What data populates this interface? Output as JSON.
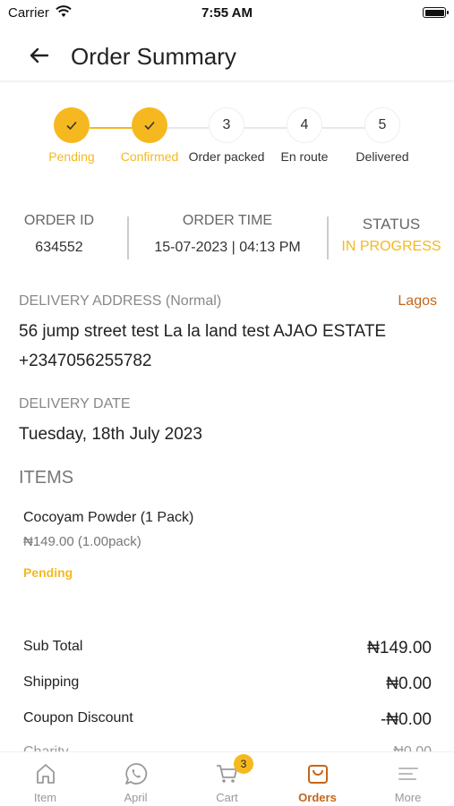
{
  "status_bar": {
    "carrier": "Carrier",
    "time": "7:55 AM"
  },
  "header": {
    "title": "Order Summary",
    "back_icon": "arrow-left-icon"
  },
  "progress": {
    "steps": [
      {
        "label": "Pending",
        "done": true
      },
      {
        "label": "Confirmed",
        "done": true
      },
      {
        "label": "Order packed",
        "number": "3",
        "done": false
      },
      {
        "label": "En route",
        "number": "4",
        "done": false
      },
      {
        "label": "Delivered",
        "number": "5",
        "done": false
      }
    ]
  },
  "order_info": {
    "id_label": "ORDER ID",
    "id_value": "634552",
    "time_label": "ORDER TIME",
    "time_value": "15-07-2023 | 04:13 PM",
    "status_label": "STATUS",
    "status_value": "IN PROGRESS"
  },
  "delivery": {
    "address_label": "DELIVERY ADDRESS (Normal)",
    "city": "Lagos",
    "address": "56 jump street test La la land test AJAO ESTATE",
    "phone": "+2347056255782",
    "date_label": "DELIVERY DATE",
    "date_value": "Tuesday, 18th July 2023"
  },
  "items": {
    "heading": "ITEMS",
    "list": [
      {
        "name": "Cocoyam Powder (1 Pack)",
        "price": "₦149.00 (1.00pack)",
        "status": "Pending"
      }
    ]
  },
  "summary": {
    "rows": [
      {
        "label": "Sub Total",
        "value": "₦149.00"
      },
      {
        "label": "Shipping",
        "value": "₦0.00"
      },
      {
        "label": "Coupon Discount",
        "value": "-₦0.00"
      },
      {
        "label": "Charity",
        "value": "₦0.00"
      }
    ]
  },
  "tabbar": {
    "tabs": [
      {
        "label": "Item",
        "icon": "home-icon"
      },
      {
        "label": "April",
        "icon": "whatsapp-icon"
      },
      {
        "label": "Cart",
        "icon": "cart-icon",
        "badge": "3"
      },
      {
        "label": "Orders",
        "icon": "shopping-bag-icon",
        "active": true
      },
      {
        "label": "More",
        "icon": "menu-lines-icon"
      }
    ]
  },
  "colors": {
    "accent": "#F5B91F",
    "brand": "#C4651A"
  }
}
